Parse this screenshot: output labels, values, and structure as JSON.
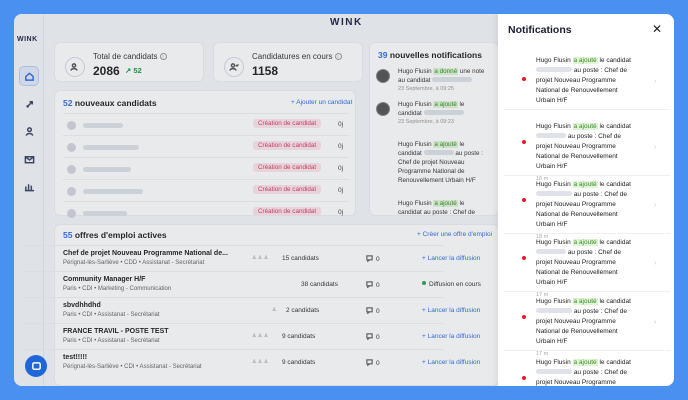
{
  "brand": "WINK",
  "stats": [
    {
      "label": "Total de candidats",
      "value": "2086",
      "delta": "52"
    },
    {
      "label": "Candidatures en cours",
      "value": "1158"
    }
  ],
  "new_candidates": {
    "count": "52",
    "title": "nouveaux candidats",
    "add_label": "+ Ajouter un candidat",
    "tag": "Création de candidat",
    "date": "0j"
  },
  "notifications_card": {
    "count": "39",
    "title": "nouvelles notifications",
    "items": [
      {
        "name": "Hugo Flusin",
        "action": "a donné",
        "rest": "une note au candidat",
        "date": "23 Septembre, à 09:25"
      },
      {
        "name": "Hugo Flusin",
        "action": "a ajouté",
        "rest": "le candidat",
        "date": "23 Septembre, à 09:23"
      },
      {
        "name": "Hugo Flusin",
        "action": "a ajouté",
        "rest": "le candidat",
        "mid": "au poste :",
        "job": "Chef de projet Nouveau Programme National de Renouvellement Urbain H/F"
      },
      {
        "name": "Hugo Flusin",
        "action": "a ajouté",
        "rest": "le candidat",
        "mid": "au poste : Chef de"
      }
    ]
  },
  "offers": {
    "count": "55",
    "title": "offres d'emploi actives",
    "create_label": "+ Créer une offre d'emploi",
    "rows": [
      {
        "title": "Chef de projet Nouveau Programme National de...",
        "sub": "Pérignat-lès-Sarliève • CDD • Assistanat - Secrétariat",
        "avs": "♙ ♙ ♙",
        "cands": "15 candidats",
        "msgs": "0",
        "action": "+ Lancer la diffusion",
        "live": false
      },
      {
        "title": "Community Manager H/F",
        "sub": "Paris • CDI • Marketing - Communication",
        "avs": "",
        "cands": "38 candidats",
        "msgs": "0",
        "action": "Diffusion en cours",
        "live": true
      },
      {
        "title": "sbvdhhdhd",
        "sub": "Paris • CDI • Assistanat - Secrétariat",
        "avs": "♙",
        "cands": "2 candidats",
        "msgs": "0",
        "action": "+ Lancer la diffusion",
        "live": false
      },
      {
        "title": "FRANCE TRAVIL - POSTE TEST",
        "sub": "Paris • CDI • Assistanat - Secrétariat",
        "avs": "♙ ♙ ♙",
        "cands": "9 candidats",
        "msgs": "0",
        "action": "+ Lancer la diffusion",
        "live": false
      },
      {
        "title": "test!!!!!",
        "sub": "Pérignat-lès-Sarliève • CDI • Assistanat - Secrétariat",
        "avs": "♙ ♙ ♙",
        "cands": "9 candidats",
        "msgs": "0",
        "action": "+ Lancer la diffusion",
        "live": false
      }
    ]
  },
  "panel": {
    "title": "Notifications",
    "close": "✕",
    "items": [
      {
        "name": "Hugo Flusin",
        "action": "a ajouté",
        "l1": "le candidat",
        "l2": "au poste :",
        "job": "Chef de projet Nouveau Programme National de Renouvellement Urbain H/F",
        "date": "18 m"
      },
      {
        "name": "Hugo Flusin",
        "action": "a ajouté",
        "l1": "le candidat",
        "l2": "au poste : Chef de",
        "job": "projet Nouveau Programme National de Renouvellement Urbain H/F",
        "date": "18 m"
      },
      {
        "name": "Hugo Flusin",
        "action": "a ajouté",
        "l1": "le candidat",
        "l2": "au poste :",
        "job": "Chef de projet Nouveau Programme National de Renouvellement Urbain H/F",
        "date": "18 m"
      },
      {
        "name": "Hugo Flusin",
        "action": "a ajouté",
        "l1": "le candidat",
        "l2": "au poste : Chef de",
        "job": "projet Nouveau Programme National de Renouvellement Urbain H/F",
        "date": "17 m"
      },
      {
        "name": "Hugo Flusin",
        "action": "a ajouté",
        "l1": "le candidat",
        "l2": "au poste :",
        "job": "Chef de projet Nouveau Programme National de Renouvellement Urbain H/F",
        "date": "17 m"
      },
      {
        "name": "Hugo Flusin",
        "action": "a ajouté",
        "l1": "le candidat",
        "l2": "au poste :",
        "job": "Chef de projet Nouveau Programme",
        "date": ""
      }
    ]
  }
}
